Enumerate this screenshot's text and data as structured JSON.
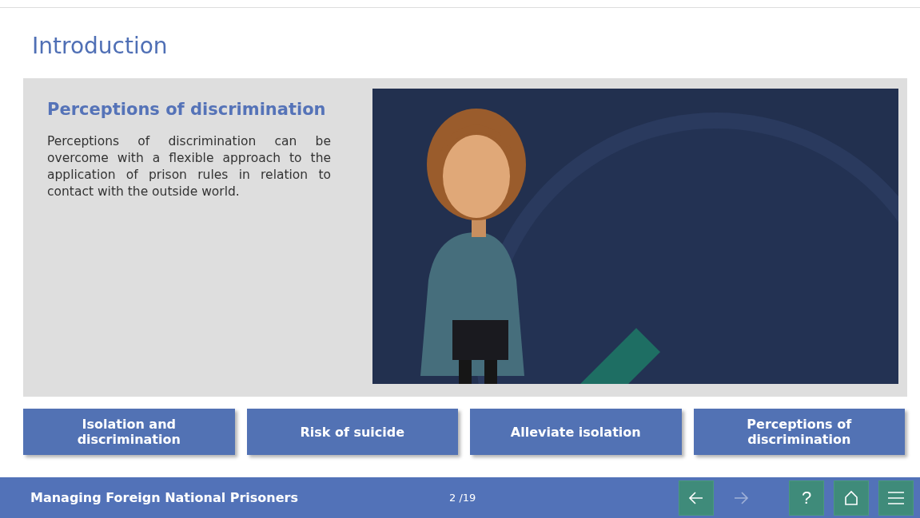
{
  "page": {
    "title": "Introduction"
  },
  "content": {
    "heading": "Perceptions of discrimination",
    "body": "Perceptions of discrimination can be overcome with a flexible approach to the application of prison rules in relation to contact with the outside world."
  },
  "topics": [
    {
      "label": "Isolation and discrimination"
    },
    {
      "label": "Risk of suicide"
    },
    {
      "label": "Alleviate isolation"
    },
    {
      "label": "Perceptions of discrimination"
    }
  ],
  "footer": {
    "course_title": "Managing Foreign National Prisoners",
    "page_counter": "2 /19",
    "nav_buttons": [
      {
        "kind": "back",
        "disabled": false
      },
      {
        "kind": "forward",
        "disabled": true
      }
    ],
    "tool_buttons": [
      {
        "kind": "help",
        "label": "?"
      },
      {
        "kind": "home"
      },
      {
        "kind": "menu"
      }
    ]
  }
}
